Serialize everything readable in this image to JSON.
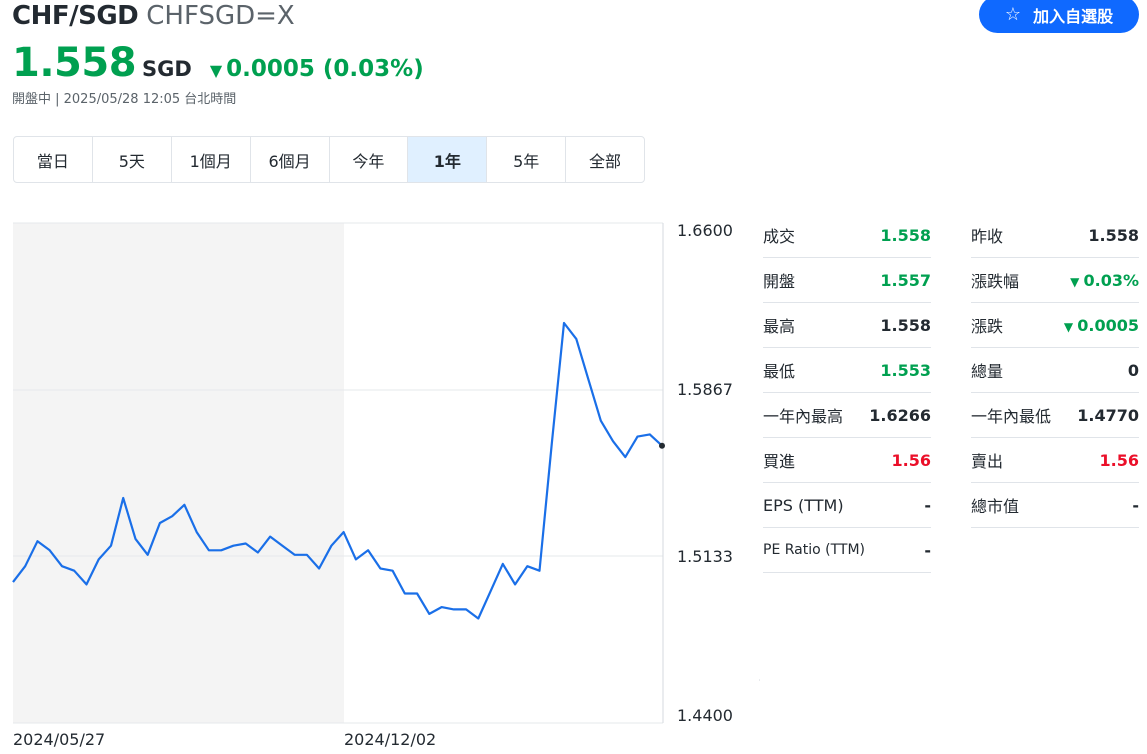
{
  "header": {
    "pair": "CHF/SGD",
    "code": "CHFSGD=X",
    "watch_label": "加入自選股",
    "star_icon": "star-outline-icon"
  },
  "price": {
    "value": "1.558",
    "currency": "SGD",
    "change": "0.0005 (0.03%)",
    "change_direction": "down",
    "status": "開盤中 | 2025/05/28 12:05 台北時間"
  },
  "tabs": [
    {
      "label": "當日",
      "active": false
    },
    {
      "label": "5天",
      "active": false
    },
    {
      "label": "1個月",
      "active": false
    },
    {
      "label": "6個月",
      "active": false
    },
    {
      "label": "今年",
      "active": false
    },
    {
      "label": "1年",
      "active": true
    },
    {
      "label": "5年",
      "active": false
    },
    {
      "label": "全部",
      "active": false
    }
  ],
  "chart_data": {
    "type": "line",
    "y_ticks": [
      "1.6600",
      "1.5867",
      "1.5133",
      "1.4400"
    ],
    "ylim": [
      1.44,
      1.66
    ],
    "x_labels": [
      "2024/05/27",
      "2024/12/02"
    ],
    "previous_close": 1.558,
    "series": [
      {
        "values": [
          1.502,
          1.509,
          1.52,
          1.516,
          1.509,
          1.507,
          1.501,
          1.512,
          1.518,
          1.539,
          1.521,
          1.514,
          1.528,
          1.531,
          1.536,
          1.524,
          1.516,
          1.516,
          1.518,
          1.519,
          1.515,
          1.522,
          1.518,
          1.514,
          1.514,
          1.508,
          1.518,
          1.524,
          1.512,
          1.516,
          1.508,
          1.507,
          1.497,
          1.497,
          1.488,
          1.491,
          1.49,
          1.49,
          1.486,
          1.498,
          1.51,
          1.501,
          1.509,
          1.507,
          1.563,
          1.616,
          1.609,
          1.591,
          1.573,
          1.564,
          1.557,
          1.566,
          1.567,
          1.562
        ],
        "color": "#1a6fe8"
      }
    ],
    "colors": {
      "line": "#1a6fe8",
      "shade": "#f4f4f4",
      "grid": "#e6e8eb"
    }
  },
  "quote_left": [
    {
      "label": "成交",
      "value": "1.558",
      "tone": "green"
    },
    {
      "label": "開盤",
      "value": "1.557",
      "tone": "green"
    },
    {
      "label": "最高",
      "value": "1.558",
      "tone": "black"
    },
    {
      "label": "最低",
      "value": "1.553",
      "tone": "green"
    },
    {
      "label": "一年內最高",
      "value": "1.6266",
      "tone": "black"
    },
    {
      "label": "買進",
      "value": "1.56",
      "tone": "red"
    },
    {
      "label": "EPS (TTM)",
      "value": "-",
      "tone": "black"
    },
    {
      "label": "PE Ratio (TTM)",
      "value": "-",
      "tone": "black"
    }
  ],
  "quote_right": [
    {
      "label": "昨收",
      "value": "1.558",
      "tone": "black"
    },
    {
      "label": "漲跌幅",
      "value": "0.03%",
      "tone": "green",
      "arrow": true
    },
    {
      "label": "漲跌",
      "value": "0.0005",
      "tone": "green",
      "arrow": true
    },
    {
      "label": "總量",
      "value": "0",
      "tone": "black"
    },
    {
      "label": "一年內最低",
      "value": "1.4770",
      "tone": "black"
    },
    {
      "label": "賣出",
      "value": "1.56",
      "tone": "red"
    },
    {
      "label": "總市值",
      "value": "-",
      "tone": "black"
    }
  ]
}
